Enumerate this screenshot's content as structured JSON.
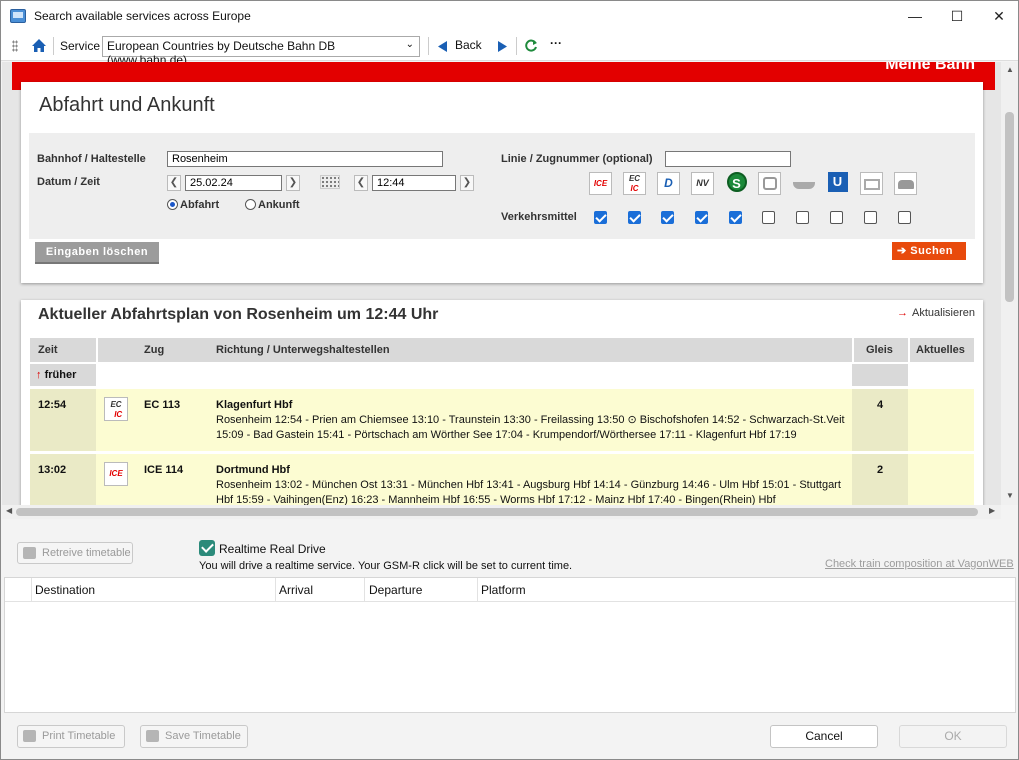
{
  "window": {
    "title": "Search available services across Europe",
    "minimize": "—",
    "maximize": "☐",
    "close": "✕"
  },
  "toolbar": {
    "service_label": "Service",
    "service_value": "European Countries by Deutsche Bahn DB (www.bahn.de)",
    "back_label": "Back",
    "more": "···"
  },
  "site": {
    "brand": "Meine Bahn"
  },
  "search_form": {
    "heading": "Abfahrt und Ankunft",
    "station_label": "Bahnhof / Haltestelle",
    "station_value": "Rosenheim",
    "datetime_label": "Datum / Zeit",
    "date_value": "25.02.24",
    "time_value": "12:44",
    "radio_departure": "Abfahrt",
    "radio_arrival": "Ankunft",
    "line_label": "Linie / Zugnummer (optional)",
    "transport_label": "Verkehrsmittel",
    "transport_modes": [
      {
        "icon": "ICE",
        "checked": true
      },
      {
        "icon": "EC IC",
        "checked": true
      },
      {
        "icon": "D",
        "checked": true
      },
      {
        "icon": "NV",
        "checked": true
      },
      {
        "icon": "S",
        "checked": true
      },
      {
        "icon": "bus",
        "checked": false
      },
      {
        "icon": "ferry",
        "checked": false
      },
      {
        "icon": "U",
        "checked": false
      },
      {
        "icon": "tram",
        "checked": false
      },
      {
        "icon": "taxi",
        "checked": false
      }
    ],
    "clear_button": "Eingaben löschen",
    "search_button": "Suchen"
  },
  "timetable": {
    "heading": "Aktueller Abfahrtsplan von Rosenheim um 12:44 Uhr",
    "refresh_label": "Aktualisieren",
    "col_time": "Zeit",
    "col_train": "Zug",
    "col_direction": "Richtung / Unterwegshaltestellen",
    "col_platform": "Gleis",
    "col_current": "Aktuelles",
    "earlier_label": "früher",
    "rows": [
      {
        "time": "12:54",
        "icon": "EC IC",
        "train": "EC 113",
        "destination": "Klagenfurt Hbf",
        "stops": "Rosenheim 12:54 - Prien am Chiemsee 13:10 - Traunstein 13:30 - Freilassing 13:50 ⊙ Bischofshofen 14:52 - Schwarzach-St.Veit 15:09 - Bad Gastein 15:41 - Pörtschach am Wörther See 17:04 - Krumpendorf/Wörthersee 17:11 - Klagenfurt Hbf 17:19",
        "platform": "4"
      },
      {
        "time": "13:02",
        "icon": "ICE",
        "train": "ICE 114",
        "destination": "Dortmund Hbf",
        "stops": "Rosenheim 13:02 - München Ost 13:31 - München Hbf 13:41 - Augsburg Hbf 14:14 - Günzburg 14:46 - Ulm Hbf 15:01 - Stuttgart Hbf 15:59 - Vaihingen(Enz) 16:23 - Mannheim Hbf 16:55 - Worms Hbf 17:12 - Mainz Hbf 17:40 - Bingen(Rhein) Hbf",
        "platform": "2"
      }
    ]
  },
  "lower": {
    "retrieve_button": "Retreive timetable",
    "realtime_label": "Realtime Real Drive",
    "realtime_checked": true,
    "realtime_note": "You will drive a realtime service. Your GSM-R click will be set to current time.",
    "vagonweb_link": "Check train composition at VagonWEB",
    "grid_columns": [
      "Destination",
      "Arrival",
      "Departure",
      "Platform"
    ],
    "print_button": "Print Timetable",
    "save_button": "Save Timetable",
    "cancel_button": "Cancel",
    "ok_button": "OK"
  }
}
